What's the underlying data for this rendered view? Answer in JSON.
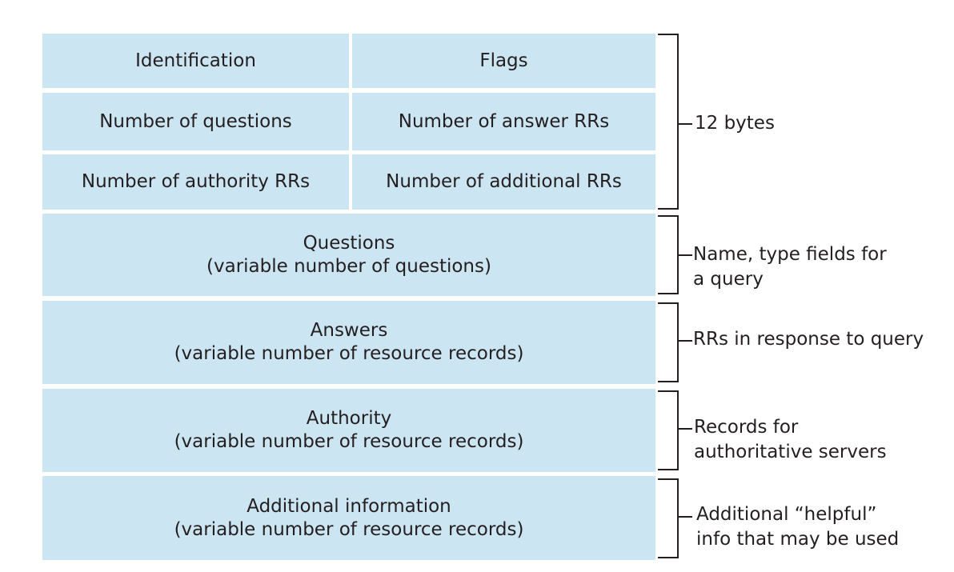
{
  "header_rows": [
    [
      "Identification",
      "Flags"
    ],
    [
      "Number of questions",
      "Number of answer RRs"
    ],
    [
      "Number of authority RRs",
      "Number of additional RRs"
    ]
  ],
  "sections": [
    {
      "title": "Questions",
      "subtitle": "(variable number of questions)",
      "annotation": [
        "Name, type fields for",
        "a query"
      ]
    },
    {
      "title": "Answers",
      "subtitle": "(variable number of resource records)",
      "annotation": [
        "RRs in response to query"
      ]
    },
    {
      "title": "Authority",
      "subtitle": "(variable number of resource records)",
      "annotation": [
        "Records for",
        "authoritative servers"
      ]
    },
    {
      "title": "Additional information",
      "subtitle": "(variable number of resource records)",
      "annotation": [
        "Additional “helpful”",
        "info that may be used"
      ]
    }
  ],
  "header_annotation": "12 bytes",
  "colors": {
    "field_fill": "#cce5f2",
    "text": "#231f20"
  }
}
